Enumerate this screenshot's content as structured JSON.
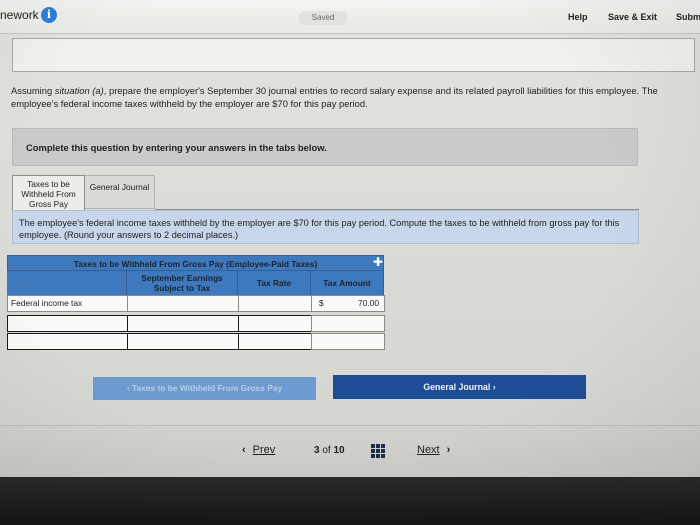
{
  "header": {
    "title": "nework",
    "saved": "Saved",
    "help": "Help",
    "save_exit": "Save & Exit",
    "submit": "Subm"
  },
  "question": {
    "lead": "Assuming ",
    "situation": "situation (a)",
    "rest": ", prepare the employer's September 30 journal entries to record salary expense and its related payroll liabilities for this employee. The employee's federal income taxes withheld by the employer are $70 for this pay period."
  },
  "instruction": "Complete this question by entering your answers in the tabs below.",
  "tabs": [
    {
      "label": "Taxes to be Withheld From Gross Pay",
      "active": true
    },
    {
      "label": "General Journal",
      "active": false
    }
  ],
  "tab_description": "The employee's federal income taxes withheld by the employer are $70 for this pay period. Compute the taxes to be withheld from gross pay for this employee. (Round your answers to 2 decimal places.)",
  "table": {
    "caption": "Taxes to be Withheld From Gross Pay (Employee-Paid Taxes)",
    "columns": [
      "",
      "September Earnings Subject to Tax",
      "Tax Rate",
      "Tax Amount"
    ],
    "rows": [
      {
        "label": "Federal income tax",
        "earnings": "",
        "rate": "",
        "currency": "$",
        "amount": "70.00"
      },
      {
        "label": "",
        "earnings": "",
        "rate": "",
        "currency": "",
        "amount": ""
      },
      {
        "label": "",
        "earnings": "",
        "rate": "",
        "currency": "",
        "amount": ""
      }
    ]
  },
  "nav": {
    "prev_tab": "Taxes to be Withheld From Gross Pay",
    "next_tab": "General Journal"
  },
  "pager": {
    "prev": "Prev",
    "current": "3",
    "of_label": "of",
    "total": "10",
    "next": "Next"
  },
  "colors": {
    "table_header": "#3f79bd",
    "next_button": "#1e4d97",
    "prev_button": "#6d9bd0",
    "description_bg": "#c7d6ea",
    "info_icon": "#2f7ed8"
  },
  "icons": [
    "info-icon",
    "chevron-left-icon",
    "chevron-right-icon",
    "grid-icon",
    "move-cross-icon"
  ]
}
